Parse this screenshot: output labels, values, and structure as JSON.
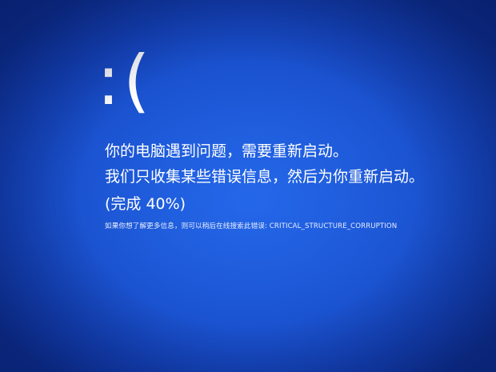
{
  "screen": {
    "background_color": "#1a4fd0",
    "frown_face": ":(",
    "message_line1": "你的电脑遇到问题，需要重新启动。",
    "message_line2": "我们只收集某些错误信息，然后为你重新启动。",
    "progress_text": "(完成 40%)",
    "progress_percent": 40,
    "info_prefix": "如果你想了解更多信息，则可以稍后在线搜索此错误: ",
    "stop_code": "CRITICAL_STRUCTURE_CORRUPTION"
  }
}
